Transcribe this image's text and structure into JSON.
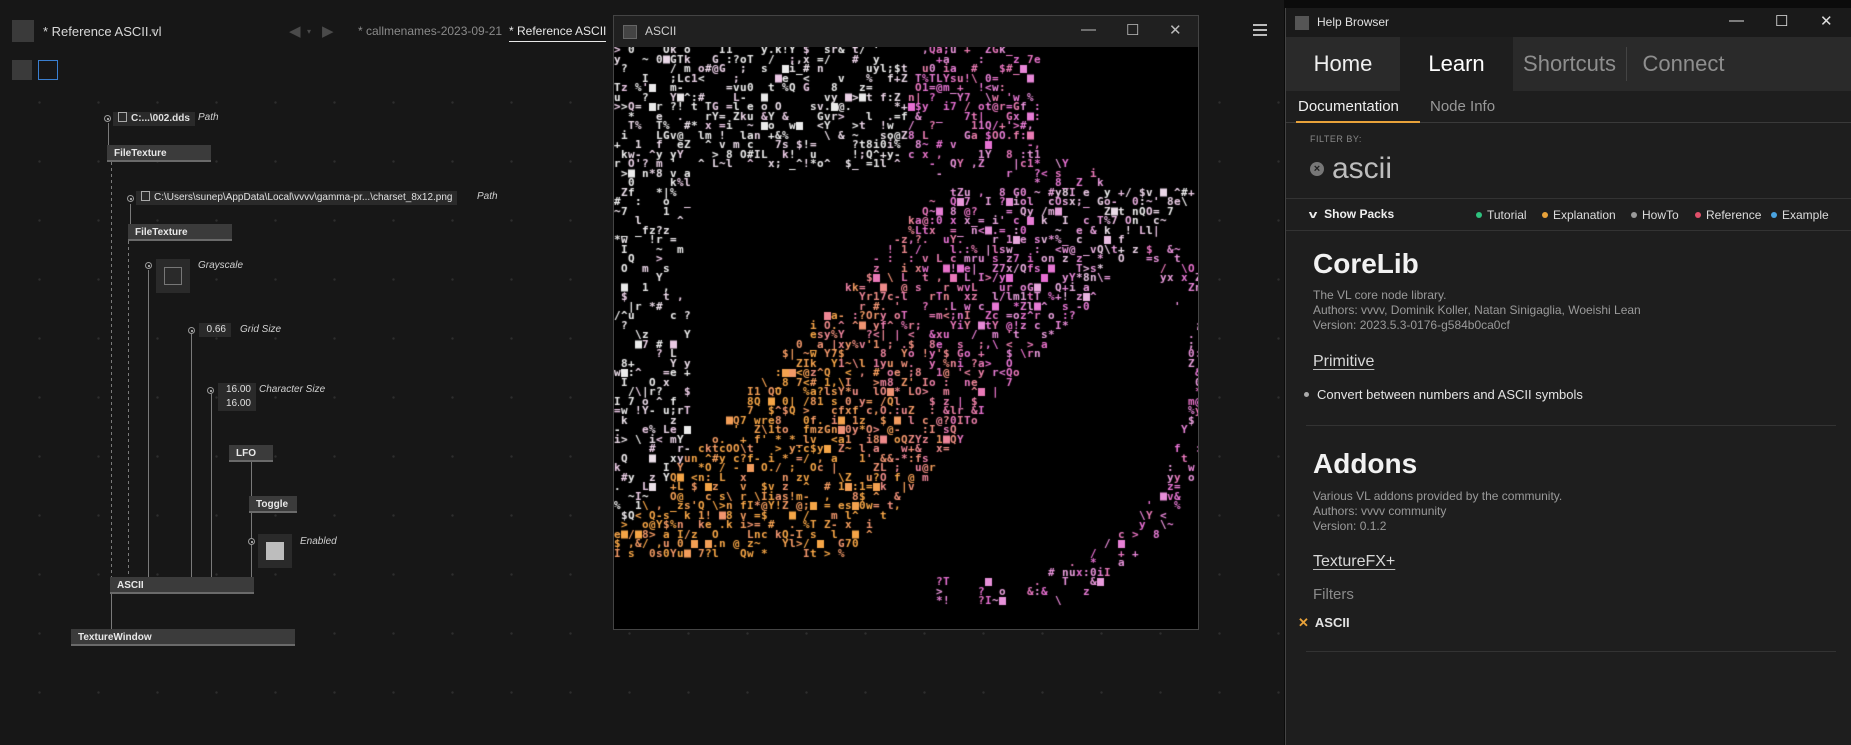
{
  "editor": {
    "doc_title": "* Reference ASCII.vl",
    "tabs": [
      "* callmenames-2023-09-21",
      "* Reference ASCII"
    ],
    "nodes": {
      "path1": "C:...\\002.dds",
      "path1_label": "Path",
      "filetexture1": "FileTexture",
      "path2": "C:\\Users\\sunep\\AppData\\Local\\vvvv\\gamma-pr...\\charset_8x12.png",
      "path2_label": "Path",
      "filetexture2": "FileTexture",
      "grayscale_label": "Grayscale",
      "gridsize_value": "0.66",
      "gridsize_label": "Grid Size",
      "charsize_x": "16.00",
      "charsize_y": "16.00",
      "charsize_label": "Character Size",
      "lfo": "LFO",
      "toggle": "Toggle",
      "enabled_label": "Enabled",
      "ascii": "ASCII",
      "texturewindow": "TextureWindow"
    }
  },
  "render_window": {
    "title": "ASCII"
  },
  "help": {
    "title": "Help Browser",
    "tabs": [
      "Home",
      "Learn",
      "Shortcuts",
      "Connect"
    ],
    "subtabs": [
      "Documentation",
      "Node Info"
    ],
    "filter_label": "FILTER BY:",
    "filter_value": "ascii",
    "show_packs": "Show Packs",
    "legend": [
      {
        "label": "Tutorial",
        "color": "#2ec27e"
      },
      {
        "label": "Explanation",
        "color": "#e8a23a"
      },
      {
        "label": "HowTo",
        "color": "#9a9a9a"
      },
      {
        "label": "Reference",
        "color": "#e0506a"
      },
      {
        "label": "Example",
        "color": "#4aa3e0"
      }
    ],
    "corelib": {
      "name": "CoreLib",
      "desc": "The VL core node library.",
      "authors": "Authors: vvvv, Dominik Koller, Natan Sinigaglia, Woeishi Lean",
      "version": "Version: 2023.5.3-0176-g584b0ca0cf",
      "category": "Primitive",
      "entry": "Convert between numbers and ASCII symbols"
    },
    "addons": {
      "name": "Addons",
      "desc": "Various VL addons provided by the community.",
      "authors": "Authors: vvvv community",
      "version": "Version: 0.1.2",
      "category": "TextureFX+",
      "subcategory": "Filters",
      "entry": "ASCII"
    }
  }
}
